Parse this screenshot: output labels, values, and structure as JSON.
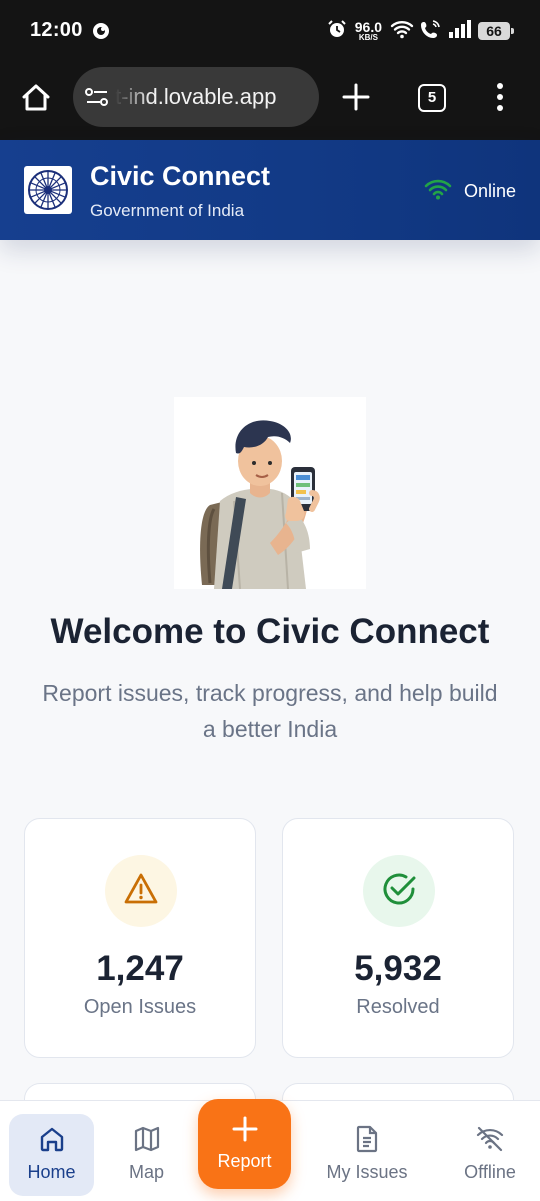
{
  "status_bar": {
    "time": "12:00",
    "net_speed": "96.0",
    "net_unit": "KB/S",
    "battery": "66"
  },
  "browser": {
    "url": "t-ind.lovable.app",
    "tab_count": "5"
  },
  "header": {
    "title": "Civic Connect",
    "subtitle": "Government of India",
    "status": "Online",
    "status_color": "#22a447",
    "background": "#123a86"
  },
  "hero": {
    "title": "Welcome to Civic Connect",
    "subtitle": "Report issues, track progress, and help build a better India"
  },
  "stats": [
    {
      "value": "1,247",
      "label": "Open Issues",
      "icon": "warning-icon",
      "color": "#c96f05",
      "bg": "#fdf6e3"
    },
    {
      "value": "5,932",
      "label": "Resolved",
      "icon": "check-circle-icon",
      "color": "#1f8f3a",
      "bg": "#e8f7ec"
    }
  ],
  "nav": {
    "home": "Home",
    "map": "Map",
    "report": "Report",
    "my_issues": "My Issues",
    "offline": "Offline",
    "active": "home",
    "accent": "#f97316"
  }
}
